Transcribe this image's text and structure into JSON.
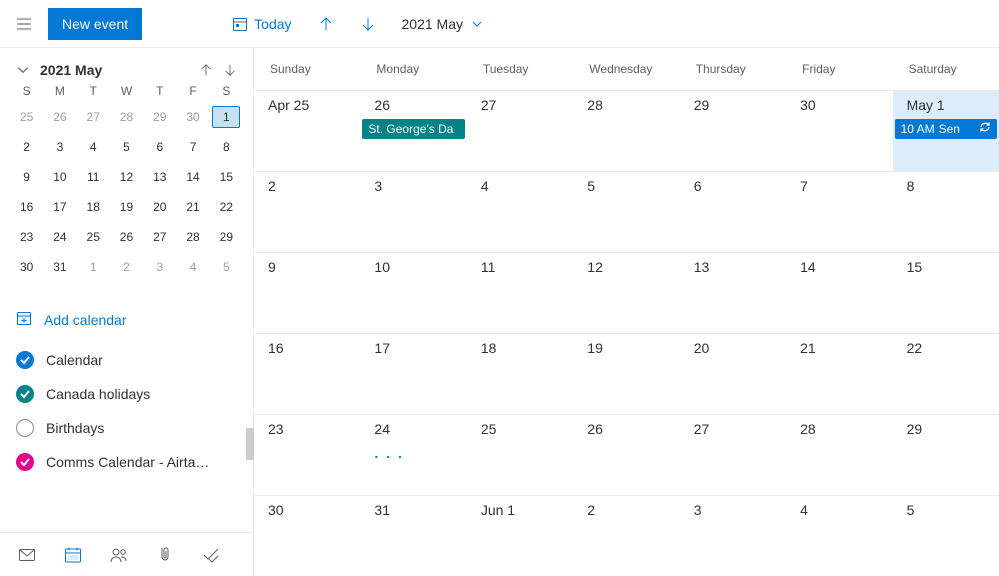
{
  "header": {
    "new_event": "New event",
    "today": "Today",
    "month_label": "2021 May"
  },
  "mini": {
    "label": "2021 May",
    "dow": [
      "S",
      "M",
      "T",
      "W",
      "T",
      "F",
      "S"
    ],
    "rows": [
      [
        {
          "n": "25",
          "out": true
        },
        {
          "n": "26",
          "out": true
        },
        {
          "n": "27",
          "out": true
        },
        {
          "n": "28",
          "out": true
        },
        {
          "n": "29",
          "out": true
        },
        {
          "n": "30",
          "out": true
        },
        {
          "n": "1",
          "sel": true
        }
      ],
      [
        {
          "n": "2"
        },
        {
          "n": "3"
        },
        {
          "n": "4"
        },
        {
          "n": "5"
        },
        {
          "n": "6"
        },
        {
          "n": "7"
        },
        {
          "n": "8"
        }
      ],
      [
        {
          "n": "9"
        },
        {
          "n": "10"
        },
        {
          "n": "11"
        },
        {
          "n": "12"
        },
        {
          "n": "13"
        },
        {
          "n": "14"
        },
        {
          "n": "15"
        }
      ],
      [
        {
          "n": "16"
        },
        {
          "n": "17"
        },
        {
          "n": "18"
        },
        {
          "n": "19"
        },
        {
          "n": "20"
        },
        {
          "n": "21"
        },
        {
          "n": "22"
        }
      ],
      [
        {
          "n": "23"
        },
        {
          "n": "24"
        },
        {
          "n": "25"
        },
        {
          "n": "26"
        },
        {
          "n": "27"
        },
        {
          "n": "28"
        },
        {
          "n": "29"
        }
      ],
      [
        {
          "n": "30"
        },
        {
          "n": "31"
        },
        {
          "n": "1",
          "out": true
        },
        {
          "n": "2",
          "out": true
        },
        {
          "n": "3",
          "out": true
        },
        {
          "n": "4",
          "out": true
        },
        {
          "n": "5",
          "out": true
        }
      ]
    ]
  },
  "add_calendar": "Add calendar",
  "calendars": [
    {
      "label": "Calendar",
      "color": "blue",
      "checked": true
    },
    {
      "label": "Canada holidays",
      "color": "teal",
      "checked": true
    },
    {
      "label": "Birthdays",
      "color": "empty",
      "checked": false
    },
    {
      "label": "Comms Calendar - Airta…",
      "color": "pink",
      "checked": true
    }
  ],
  "grid": {
    "dow": [
      "Sunday",
      "Monday",
      "Tuesday",
      "Wednesday",
      "Thursday",
      "Friday",
      "Saturday"
    ],
    "weeks": [
      [
        {
          "num": "Apr 25"
        },
        {
          "num": "26",
          "event": {
            "style": "green",
            "label": "St. George's Da"
          }
        },
        {
          "num": "27"
        },
        {
          "num": "28"
        },
        {
          "num": "29"
        },
        {
          "num": "30"
        },
        {
          "num": "May 1",
          "today": true,
          "event": {
            "style": "blue",
            "time": "10 AM",
            "label": "Sen",
            "sync": true
          }
        }
      ],
      [
        {
          "num": "2"
        },
        {
          "num": "3"
        },
        {
          "num": "4"
        },
        {
          "num": "5"
        },
        {
          "num": "6"
        },
        {
          "num": "7"
        },
        {
          "num": "8"
        }
      ],
      [
        {
          "num": "9"
        },
        {
          "num": "10"
        },
        {
          "num": "11"
        },
        {
          "num": "12"
        },
        {
          "num": "13"
        },
        {
          "num": "14"
        },
        {
          "num": "15"
        }
      ],
      [
        {
          "num": "16"
        },
        {
          "num": "17"
        },
        {
          "num": "18"
        },
        {
          "num": "19"
        },
        {
          "num": "20"
        },
        {
          "num": "21"
        },
        {
          "num": "22"
        }
      ],
      [
        {
          "num": "23"
        },
        {
          "num": "24",
          "more": true
        },
        {
          "num": "25"
        },
        {
          "num": "26"
        },
        {
          "num": "27"
        },
        {
          "num": "28"
        },
        {
          "num": "29"
        }
      ],
      [
        {
          "num": "30"
        },
        {
          "num": "31"
        },
        {
          "num": "Jun 1"
        },
        {
          "num": "2"
        },
        {
          "num": "3"
        },
        {
          "num": "4"
        },
        {
          "num": "5"
        }
      ]
    ]
  },
  "more_label": ". . ."
}
